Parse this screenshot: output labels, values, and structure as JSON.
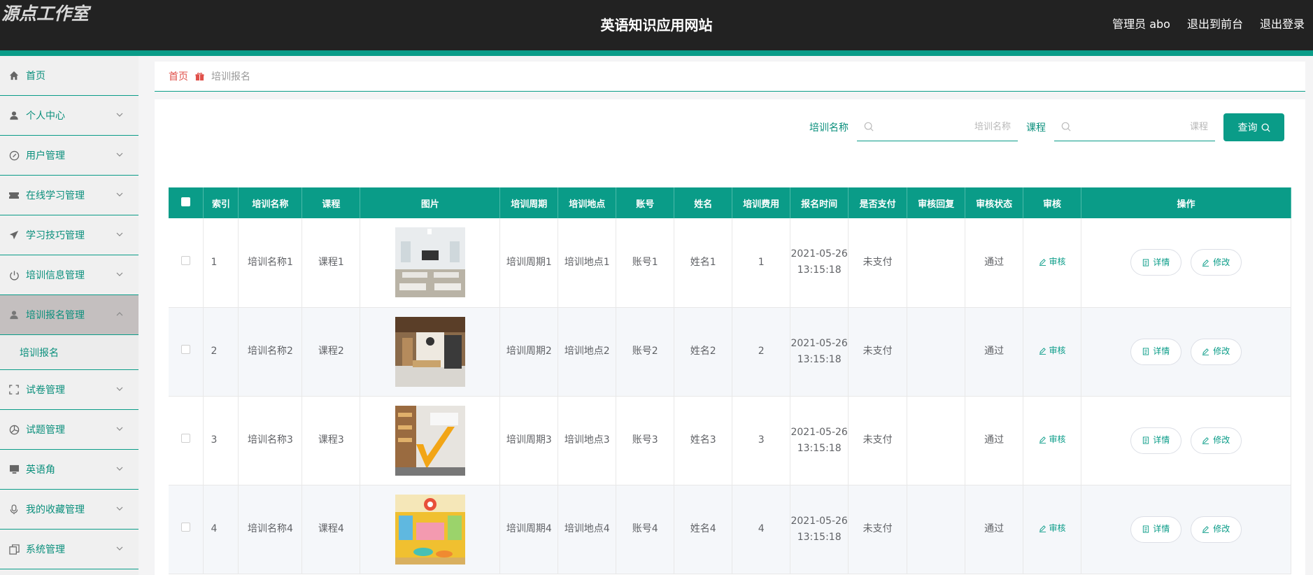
{
  "header": {
    "brand": "源点工作室",
    "title": "英语知识应用网站",
    "user_label": "管理员 abo",
    "front_link": "退出到前台",
    "logout": "退出登录"
  },
  "sidebar": {
    "items": [
      {
        "label": "首页",
        "icon": "home-icon"
      },
      {
        "label": "个人中心",
        "icon": "user-icon"
      },
      {
        "label": "用户管理",
        "icon": "compass-icon"
      },
      {
        "label": "在线学习管理",
        "icon": "ticket-icon"
      },
      {
        "label": "学习技巧管理",
        "icon": "send-icon"
      },
      {
        "label": "培训信息管理",
        "icon": "power-icon"
      },
      {
        "label": "培训报名管理",
        "icon": "user-icon"
      },
      {
        "label": "试卷管理",
        "icon": "fullscreen-icon"
      },
      {
        "label": "试题管理",
        "icon": "aperture-icon"
      },
      {
        "label": "英语角",
        "icon": "monitor-icon"
      },
      {
        "label": "我的收藏管理",
        "icon": "microphone-icon"
      },
      {
        "label": "系统管理",
        "icon": "copy-icon"
      }
    ],
    "sub_item": "培训报名"
  },
  "breadcrumb": {
    "home": "首页",
    "current": "培训报名"
  },
  "search": {
    "name_label": "培训名称",
    "name_placeholder": "培训名称",
    "course_label": "课程",
    "course_placeholder": "课程",
    "query_button": "查询"
  },
  "table": {
    "headers": [
      "索引",
      "培训名称",
      "课程",
      "图片",
      "培训周期",
      "培训地点",
      "账号",
      "姓名",
      "培训费用",
      "报名时间",
      "是否支付",
      "审核回复",
      "审核状态",
      "审核",
      "操作"
    ],
    "audit_label": "审核",
    "detail_label": "详情",
    "edit_label": "修改",
    "rows": [
      {
        "index": "1",
        "name": "培训名称1",
        "course": "课程1",
        "period": "培训周期1",
        "place": "培训地点1",
        "account": "账号1",
        "person": "姓名1",
        "fee": "1",
        "time": "2021-05-26 13:15:18",
        "paid": "未支付",
        "reply": "",
        "status": "通过"
      },
      {
        "index": "2",
        "name": "培训名称2",
        "course": "课程2",
        "period": "培训周期2",
        "place": "培训地点2",
        "account": "账号2",
        "person": "姓名2",
        "fee": "2",
        "time": "2021-05-26 13:15:18",
        "paid": "未支付",
        "reply": "",
        "status": "通过"
      },
      {
        "index": "3",
        "name": "培训名称3",
        "course": "课程3",
        "period": "培训周期3",
        "place": "培训地点3",
        "account": "账号3",
        "person": "姓名3",
        "fee": "3",
        "time": "2021-05-26 13:15:18",
        "paid": "未支付",
        "reply": "",
        "status": "通过"
      },
      {
        "index": "4",
        "name": "培训名称4",
        "course": "课程4",
        "period": "培训周期4",
        "place": "培训地点4",
        "account": "账号4",
        "person": "姓名4",
        "fee": "4",
        "time": "2021-05-26 13:15:18",
        "paid": "未支付",
        "reply": "",
        "status": "通过"
      }
    ]
  },
  "colors": {
    "accent": "#0a9c88",
    "header_bg": "#222222",
    "breadcrumb_home": "#e0504a"
  }
}
